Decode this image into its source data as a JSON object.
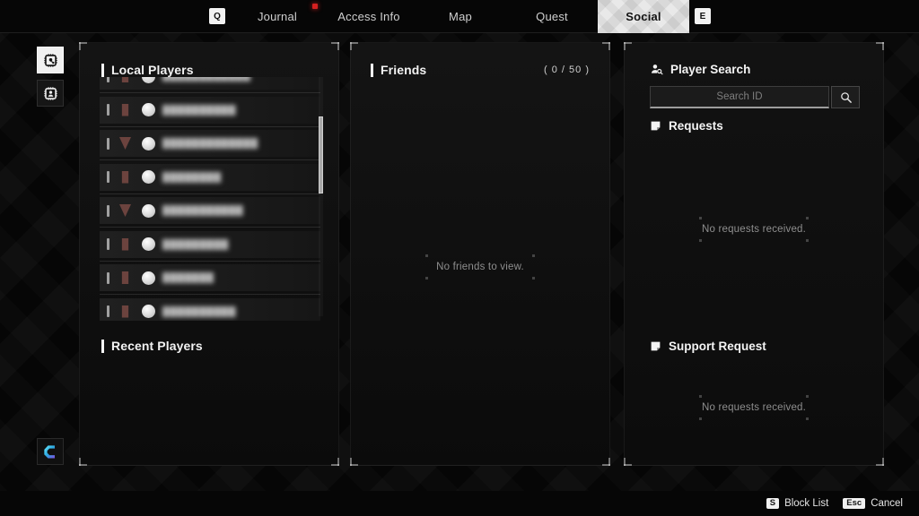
{
  "nav": {
    "left_key": "Q",
    "right_key": "E",
    "tabs": [
      {
        "label": "Journal",
        "active": false
      },
      {
        "label": "Access Info",
        "active": false
      },
      {
        "label": "Map",
        "active": false
      },
      {
        "label": "Quest",
        "active": false
      },
      {
        "label": "Social",
        "active": true
      }
    ],
    "notification_color": "#d42020"
  },
  "rail": {
    "items": [
      {
        "icon": "chip-network-icon",
        "selected": true
      },
      {
        "icon": "chip-profile-icon",
        "selected": false
      }
    ],
    "brand": {
      "icon": "game-logo-icon",
      "color": "#2fd4e8"
    }
  },
  "local_players": {
    "title": "Local Players",
    "rows": [
      {
        "name": "████████████",
        "rank_shape": "b"
      },
      {
        "name": "██████████",
        "rank_shape": "b"
      },
      {
        "name": "█████████████",
        "rank_shape": "v"
      },
      {
        "name": "████████",
        "rank_shape": "b"
      },
      {
        "name": "███████████",
        "rank_shape": "v"
      },
      {
        "name": "█████████",
        "rank_shape": "b"
      },
      {
        "name": "███████",
        "rank_shape": "b"
      },
      {
        "name": "██████████",
        "rank_shape": "b"
      }
    ]
  },
  "recent_players": {
    "title": "Recent Players"
  },
  "friends": {
    "title": "Friends",
    "count": "( 0 / 50 )",
    "empty_text": "No friends to view."
  },
  "player_search": {
    "title": "Player Search",
    "icon": "player-search-icon",
    "placeholder": "Search ID",
    "value": "",
    "search_icon": "magnifier-icon"
  },
  "requests": {
    "title": "Requests",
    "icon": "note-icon",
    "empty_text": "No requests received."
  },
  "support_request": {
    "title": "Support Request",
    "icon": "note-icon",
    "empty_text": "No requests received."
  },
  "footer": {
    "hints": [
      {
        "key": "S",
        "label": "Block List"
      },
      {
        "key": "Esc",
        "label": "Cancel"
      }
    ]
  }
}
